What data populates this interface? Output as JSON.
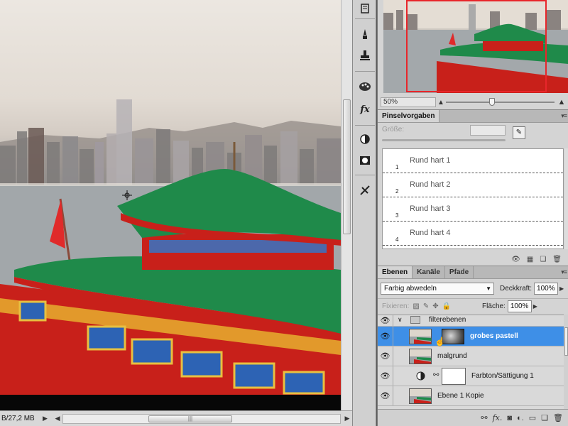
{
  "status": {
    "doc_size": "B/27,2 MB",
    "scroll_grip": "|||"
  },
  "dock": {
    "icons": [
      "history-icon",
      "brush-tool-icon",
      "clone-stamp-icon",
      "color-palette-icon",
      "fx-icon",
      "adjustment-icon",
      "mask-icon",
      "tool-presets-icon"
    ]
  },
  "navigator": {
    "zoom": "50%",
    "zoom_level_fraction": 0.42
  },
  "brush_presets": {
    "tab_label": "Pinselvorgaben",
    "size_label": "Größe:",
    "items": [
      {
        "num": "1",
        "name": "Rund hart 1"
      },
      {
        "num": "2",
        "name": "Rund hart 2"
      },
      {
        "num": "3",
        "name": "Rund hart 3"
      },
      {
        "num": "4",
        "name": "Rund hart 4"
      }
    ]
  },
  "layers_panel": {
    "tabs": [
      "Ebenen",
      "Kanäle",
      "Pfade"
    ],
    "blend_mode": "Farbig abwedeln",
    "opacity_label": "Deckkraft:",
    "opacity": "100%",
    "lock_label": "Fixieren:",
    "fill_label": "Fläche:",
    "fill": "100%",
    "layers": [
      {
        "name": "filterebenen",
        "type": "group"
      },
      {
        "name": "grobes pastell",
        "type": "smart",
        "selected": true
      },
      {
        "name": "malgrund",
        "type": "normal"
      },
      {
        "name": "Farbton/Sättigung 1",
        "type": "adjustment"
      },
      {
        "name": "Ebene 1 Kopie",
        "type": "normal"
      }
    ]
  },
  "colors": {
    "selection": "#3e8fe7",
    "nav_frame": "#e8262b",
    "roof_green": "#1f8a4a",
    "boat_red": "#c8201a"
  }
}
